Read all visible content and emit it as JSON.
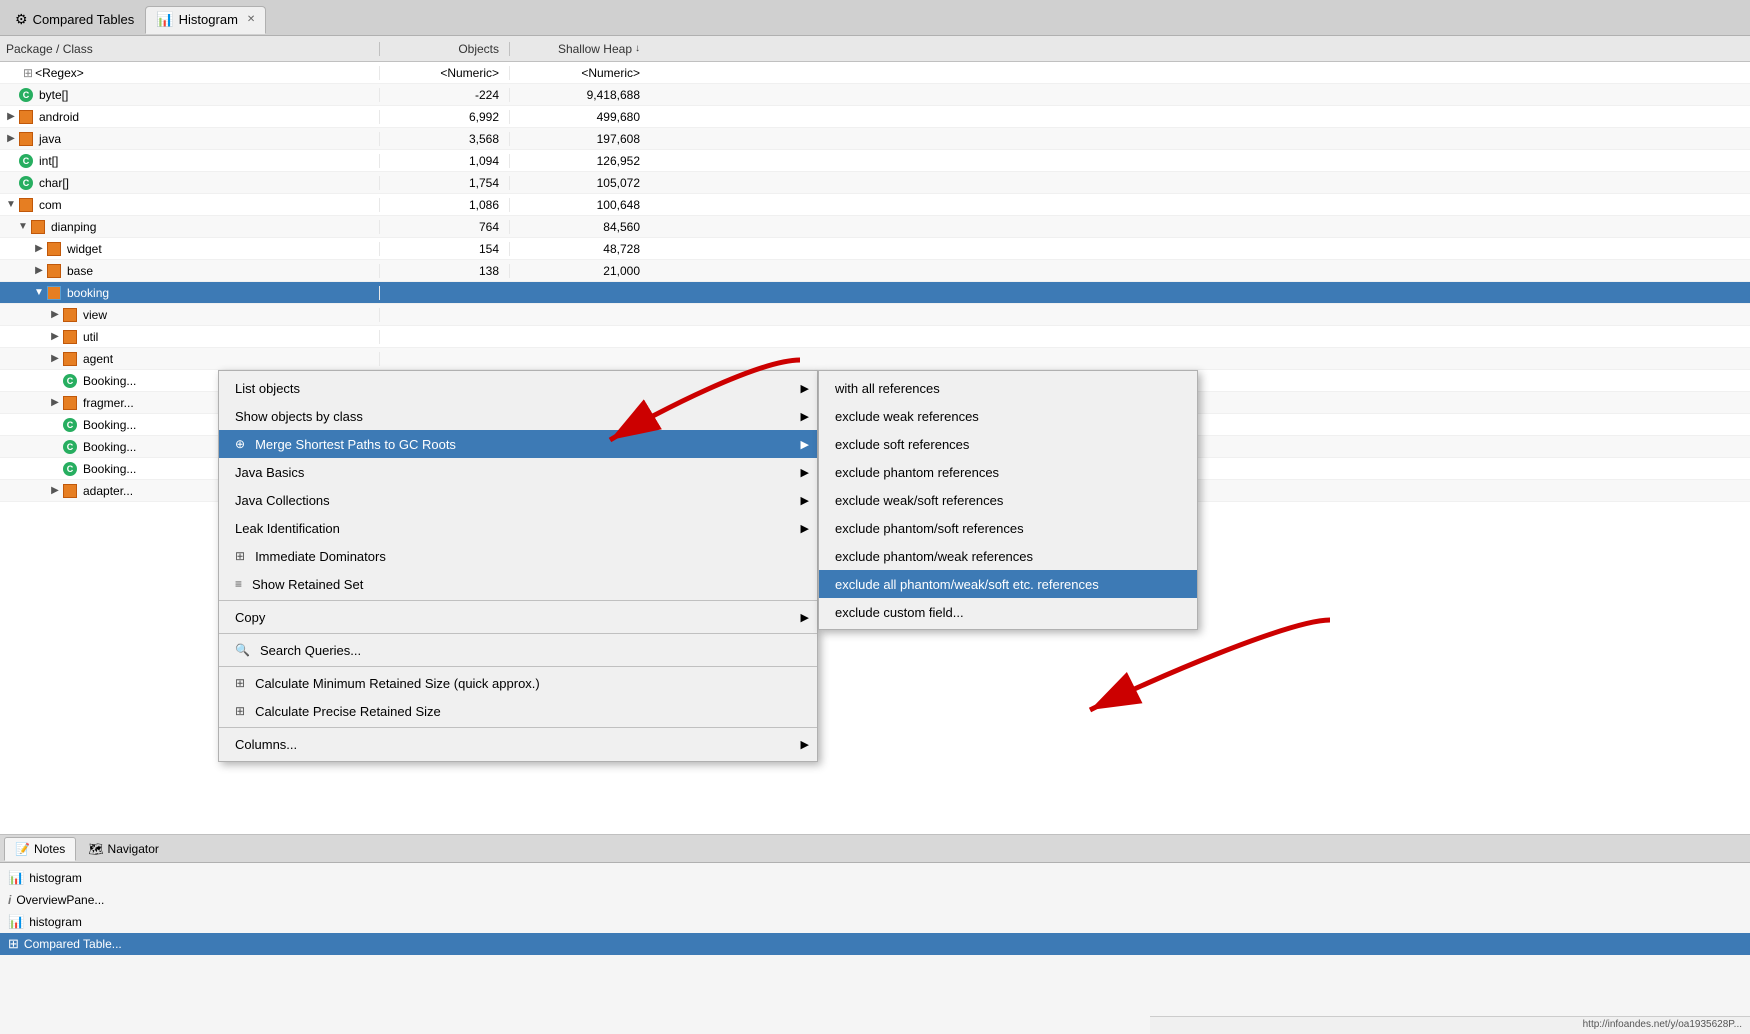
{
  "tabs": [
    {
      "id": "compared-tables",
      "label": "Compared Tables",
      "icon": "⚙",
      "active": false,
      "closable": false
    },
    {
      "id": "histogram",
      "label": "Histogram",
      "icon": "📊",
      "active": true,
      "closable": true
    }
  ],
  "table": {
    "columns": {
      "package": "Package / Class",
      "objects": "Objects",
      "shallowHeap": "Shallow Heap"
    },
    "rows": [
      {
        "id": 1,
        "indent": 0,
        "icon": "regex",
        "label": "<Regex>",
        "objects": "<Numeric>",
        "shallowHeap": "<Numeric>",
        "expanded": false
      },
      {
        "id": 2,
        "indent": 0,
        "icon": "c",
        "label": "byte[]",
        "objects": "-224",
        "shallowHeap": "9,418,688"
      },
      {
        "id": 3,
        "indent": 0,
        "icon": "pkg",
        "label": "android",
        "objects": "6,992",
        "shallowHeap": "499,680",
        "expanded": true
      },
      {
        "id": 4,
        "indent": 0,
        "icon": "pkg",
        "label": "java",
        "objects": "3,568",
        "shallowHeap": "197,608",
        "expanded": true
      },
      {
        "id": 5,
        "indent": 0,
        "icon": "c",
        "label": "int[]",
        "objects": "1,094",
        "shallowHeap": "126,952"
      },
      {
        "id": 6,
        "indent": 0,
        "icon": "c",
        "label": "char[]",
        "objects": "1,754",
        "shallowHeap": "105,072"
      },
      {
        "id": 7,
        "indent": 0,
        "icon": "pkg",
        "label": "com",
        "objects": "1,086",
        "shallowHeap": "100,648",
        "expanded": true
      },
      {
        "id": 8,
        "indent": 1,
        "icon": "pkg",
        "label": "dianping",
        "objects": "764",
        "shallowHeap": "84,560",
        "expanded": true
      },
      {
        "id": 9,
        "indent": 2,
        "icon": "pkg",
        "label": "widget",
        "objects": "154",
        "shallowHeap": "48,728",
        "expanded": false
      },
      {
        "id": 10,
        "indent": 2,
        "icon": "pkg",
        "label": "base",
        "objects": "138",
        "shallowHeap": "21,000",
        "expanded": false
      },
      {
        "id": 11,
        "indent": 2,
        "icon": "pkg",
        "label": "booking",
        "objects": "",
        "shallowHeap": "",
        "selected": true,
        "expanded": true
      },
      {
        "id": 12,
        "indent": 3,
        "icon": "pkg",
        "label": "view",
        "objects": "",
        "shallowHeap": ""
      },
      {
        "id": 13,
        "indent": 3,
        "icon": "pkg",
        "label": "util",
        "objects": "",
        "shallowHeap": ""
      },
      {
        "id": 14,
        "indent": 3,
        "icon": "pkg",
        "label": "agent",
        "objects": "",
        "shallowHeap": ""
      },
      {
        "id": 15,
        "indent": 3,
        "icon": "c",
        "label": "Booking...",
        "objects": "",
        "shallowHeap": ""
      },
      {
        "id": 16,
        "indent": 3,
        "icon": "pkg",
        "label": "fragmer...",
        "objects": "",
        "shallowHeap": ""
      },
      {
        "id": 17,
        "indent": 3,
        "icon": "c",
        "label": "Booking...",
        "objects": "",
        "shallowHeap": ""
      },
      {
        "id": 18,
        "indent": 3,
        "icon": "c",
        "label": "Booking...",
        "objects": "",
        "shallowHeap": ""
      },
      {
        "id": 19,
        "indent": 3,
        "icon": "c",
        "label": "Booking...",
        "objects": "",
        "shallowHeap": ""
      },
      {
        "id": 20,
        "indent": 3,
        "icon": "pkg",
        "label": "adapter...",
        "objects": "",
        "shallowHeap": ""
      }
    ]
  },
  "contextMenu": {
    "items": [
      {
        "id": "list-objects",
        "label": "List objects",
        "hasSubmenu": true
      },
      {
        "id": "show-objects-by-class",
        "label": "Show objects by class",
        "hasSubmenu": true
      },
      {
        "id": "merge-shortest-paths",
        "label": "Merge Shortest Paths to GC Roots",
        "hasSubmenu": true,
        "highlighted": true,
        "hasIcon": true
      },
      {
        "id": "java-basics",
        "label": "Java Basics",
        "hasSubmenu": true
      },
      {
        "id": "java-collections",
        "label": "Java Collections",
        "hasSubmenu": true
      },
      {
        "id": "leak-identification",
        "label": "Leak Identification",
        "hasSubmenu": true
      },
      {
        "id": "immediate-dominators",
        "label": "Immediate Dominators",
        "hasIcon": true
      },
      {
        "id": "show-retained-set",
        "label": "Show Retained Set",
        "hasIcon": true
      },
      {
        "id": "separator1",
        "type": "separator"
      },
      {
        "id": "copy",
        "label": "Copy",
        "hasSubmenu": true
      },
      {
        "id": "separator2",
        "type": "separator"
      },
      {
        "id": "search-queries",
        "label": "Search Queries...",
        "hasIcon": true
      },
      {
        "id": "separator3",
        "type": "separator"
      },
      {
        "id": "calc-min-retained",
        "label": "Calculate Minimum Retained Size (quick approx.)",
        "hasIcon": true
      },
      {
        "id": "calc-precise-retained",
        "label": "Calculate Precise Retained Size",
        "hasIcon": true
      },
      {
        "id": "separator4",
        "type": "separator"
      },
      {
        "id": "columns",
        "label": "Columns...",
        "hasSubmenu": true
      }
    ]
  },
  "submenu": {
    "items": [
      {
        "id": "with-all-refs",
        "label": "with all references"
      },
      {
        "id": "exclude-weak",
        "label": "exclude weak references"
      },
      {
        "id": "exclude-soft",
        "label": "exclude soft references"
      },
      {
        "id": "exclude-phantom",
        "label": "exclude phantom references"
      },
      {
        "id": "exclude-weak-soft",
        "label": "exclude weak/soft references"
      },
      {
        "id": "exclude-phantom-soft",
        "label": "exclude phantom/soft references"
      },
      {
        "id": "exclude-phantom-weak",
        "label": "exclude phantom/weak references"
      },
      {
        "id": "exclude-all",
        "label": "exclude all phantom/weak/soft etc. references",
        "highlighted": true
      },
      {
        "id": "exclude-custom",
        "label": "exclude custom field..."
      }
    ]
  },
  "bottomTabs": [
    {
      "id": "notes",
      "label": "Notes",
      "icon": "📝",
      "active": true
    },
    {
      "id": "navigator",
      "label": "Navigator",
      "icon": "🗺",
      "active": false
    }
  ],
  "navigatorItems": [
    {
      "id": "nav-histogram1",
      "icon": "bar",
      "label": "histogram"
    },
    {
      "id": "nav-overview",
      "icon": "i",
      "label": "OverviewPane..."
    },
    {
      "id": "nav-histogram2",
      "icon": "bar",
      "label": "histogram"
    },
    {
      "id": "nav-compared",
      "icon": "table",
      "label": "Compared Table..."
    }
  ]
}
